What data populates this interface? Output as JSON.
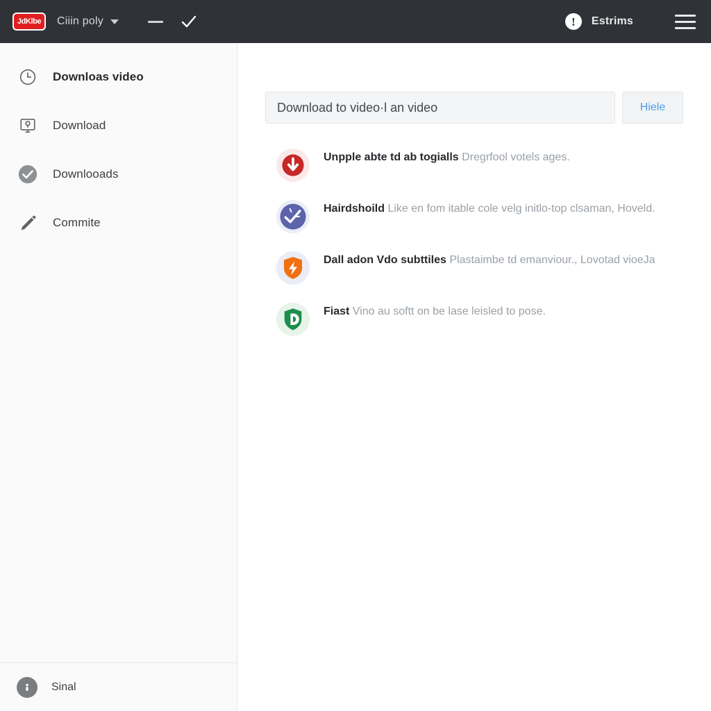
{
  "titlebar": {
    "logo_text": "JdKlbe",
    "title": "Ciiin poly",
    "caret_icon": "chevron-down-icon",
    "minimize_icon": "dash-icon",
    "confirm_icon": "check-icon",
    "alert_icon": "!",
    "right_label": "Estrims",
    "menu_icon": "hamburger-icon",
    "bg_color": "#2f3237"
  },
  "sidebar": {
    "items": [
      {
        "label": "Downloas video",
        "icon": "clock-icon",
        "active": true
      },
      {
        "label": "Download",
        "icon": "monitor-download-icon",
        "active": false
      },
      {
        "label": "Downlooads",
        "icon": "check-circle-icon",
        "active": false
      },
      {
        "label": "Commite",
        "icon": "pencil-icon",
        "active": false
      }
    ],
    "footer": {
      "label": "Sinal",
      "icon": "info-circle-icon"
    }
  },
  "main": {
    "search": {
      "value": "Download to video·l an video",
      "placeholder": "Download to video·l an video"
    },
    "action_button": {
      "label": "Hiele",
      "color": "#4a9eea"
    },
    "features": [
      {
        "title": "Unpple abte td ab togialls",
        "subtitle": "Dregrfool votels ages.",
        "icon": "download-arrow-icon",
        "color": "#c62828",
        "halo": "#fbe9e9"
      },
      {
        "title": "Hairdshoild",
        "subtitle": "Like en fom itable cole velg initlo-top clsaman, Hoveld.",
        "icon": "check-circle-icon",
        "color": "#5c63ab",
        "halo": "#eceef7"
      },
      {
        "title": "Dall adon Vdo subttiles",
        "subtitle": "Plastaimbe td emanviour., Lovotad vioeJa",
        "icon": "shield-bolt-icon",
        "color": "#f2700f",
        "halo": "#eaecf7"
      },
      {
        "title": "Fiast",
        "subtitle": "Vino au softt on be lase leisled to pose.",
        "icon": "shield-play-icon",
        "color": "#1e8e4e",
        "halo": "#e6f4ea"
      }
    ]
  }
}
